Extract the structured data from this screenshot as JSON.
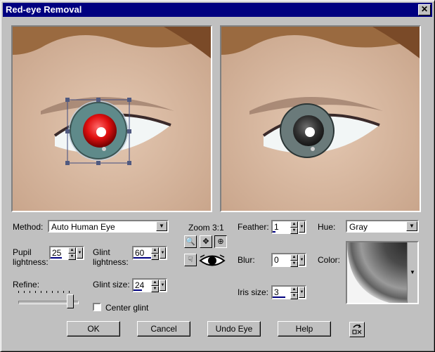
{
  "title": "Red-eye Removal",
  "close_glyph": "✕",
  "method": {
    "label": "Method:",
    "value": "Auto Human Eye"
  },
  "pupil": {
    "label_line1": "Pupil",
    "label_line2": "lightness:",
    "value": "25"
  },
  "glint": {
    "label_line1": "Glint",
    "label_line2": "lightness:",
    "value": "60"
  },
  "glint_size": {
    "label": "Glint size:",
    "value": "24"
  },
  "refine": {
    "label": "Refine:"
  },
  "center_glint": {
    "label": "Center glint",
    "checked": false
  },
  "zoom": {
    "label": "Zoom 3:1"
  },
  "feather": {
    "label": "Feather:",
    "value": "1"
  },
  "blur": {
    "label": "Blur:",
    "value": "0"
  },
  "iris_size": {
    "label": "Iris size:",
    "value": "3"
  },
  "hue": {
    "label": "Hue:",
    "value": "Gray"
  },
  "color": {
    "label": "Color:"
  },
  "buttons": {
    "ok": "OK",
    "cancel": "Cancel",
    "undo": "Undo Eye",
    "help": "Help"
  },
  "colors": {
    "titlebar": "#000080",
    "face": "#c0c0c0"
  }
}
